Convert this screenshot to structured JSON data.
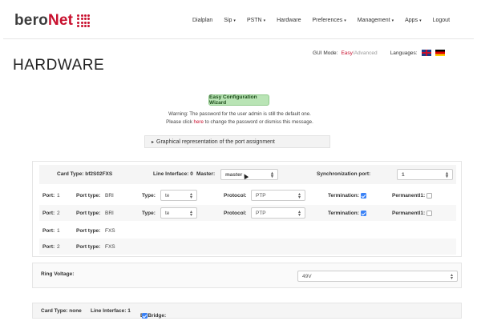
{
  "logo": {
    "part1": "bero",
    "part2": "Net"
  },
  "nav": [
    {
      "label": "Dialplan",
      "caret": false
    },
    {
      "label": "Sip",
      "caret": true
    },
    {
      "label": "PSTN",
      "caret": true
    },
    {
      "label": "Hardware",
      "caret": false
    },
    {
      "label": "Preferences",
      "caret": true
    },
    {
      "label": "Management",
      "caret": true
    },
    {
      "label": "Apps",
      "caret": true
    },
    {
      "label": "Logout",
      "caret": false
    }
  ],
  "page_title": "HARDWARE",
  "gui_mode": {
    "label": "GUI Mode:",
    "easy": "Easy",
    "sep": "/",
    "advanced": "Advanced",
    "languages_label": "Languages:"
  },
  "wizard": {
    "button": "Easy Configuration Wizard",
    "warning_line1": "Warning: The password for the user admin is still the default one.",
    "warning_pre": "Please click ",
    "warning_link": "here",
    "warning_post": " to change the password or dismiss this message."
  },
  "accordion": {
    "label": "Graphical representation of the port assignment"
  },
  "card1": {
    "card_type": "Card Type: bf2S02FXS",
    "line_interface": "Line Interface: 0",
    "master_label": "Master:",
    "master_value": "master",
    "sync_label": "Synchronization port:",
    "sync_value": "1",
    "rows": [
      {
        "port_label": "Port:",
        "port": "1",
        "ptype_label": "Port type:",
        "ptype": "BRI",
        "type_label": "Type:",
        "type": "te",
        "protocol_label": "Protocol:",
        "protocol": "PTP",
        "termination_label": "Termination:",
        "permanent_label": "Permanentl1:"
      },
      {
        "port_label": "Port:",
        "port": "2",
        "ptype_label": "Port type:",
        "ptype": "BRI",
        "type_label": "Type:",
        "type": "te",
        "protocol_label": "Protocol:",
        "protocol": "PTP",
        "termination_label": "Termination:",
        "permanent_label": "Permanentl1:"
      }
    ],
    "fxs_rows": [
      {
        "port_label": "Port:",
        "port": "1",
        "ptype_label": "Port type:",
        "ptype": "FXS"
      },
      {
        "port_label": "Port:",
        "port": "2",
        "ptype_label": "Port type:",
        "ptype": "FXS"
      }
    ]
  },
  "ring": {
    "label": "Ring Voltage:",
    "value": "49V"
  },
  "card2": {
    "card_type": "Card Type: none",
    "line_interface": "Line Interface: 1",
    "bnbridge": "BNBridge:"
  },
  "colors": {
    "brand_red": "#c8102e",
    "wizard_green": "#b9e4b5",
    "check_blue": "#3b82f6"
  }
}
